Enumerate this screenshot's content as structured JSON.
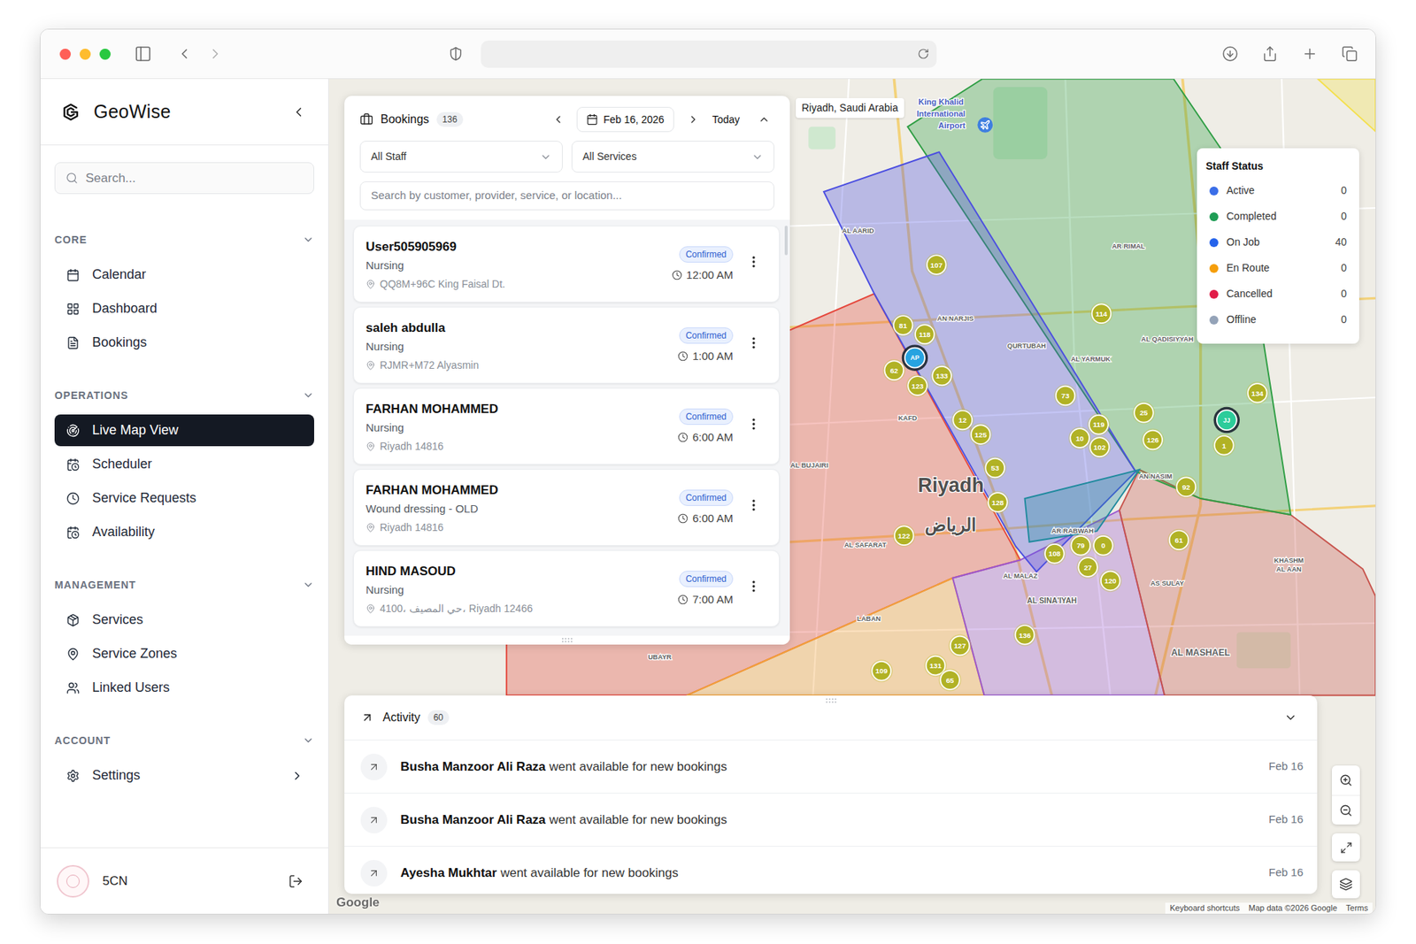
{
  "sidebar": {
    "brand": "GeoWise",
    "search_placeholder": "Search...",
    "sections": [
      {
        "title": "CORE",
        "expanded": true,
        "items": [
          {
            "label": "Calendar",
            "selected": false,
            "submenu": false
          },
          {
            "label": "Dashboard",
            "selected": false,
            "submenu": false
          },
          {
            "label": "Bookings",
            "selected": false,
            "submenu": false
          }
        ]
      },
      {
        "title": "OPERATIONS",
        "expanded": true,
        "items": [
          {
            "label": "Live Map View",
            "selected": true,
            "submenu": false
          },
          {
            "label": "Scheduler",
            "selected": false,
            "submenu": false
          },
          {
            "label": "Service Requests",
            "selected": false,
            "submenu": false
          },
          {
            "label": "Availability",
            "selected": false,
            "submenu": false
          }
        ]
      },
      {
        "title": "MANAGEMENT",
        "expanded": true,
        "items": [
          {
            "label": "Services",
            "selected": false,
            "submenu": false
          },
          {
            "label": "Service Zones",
            "selected": false,
            "submenu": false
          },
          {
            "label": "Linked Users",
            "selected": false,
            "submenu": false
          }
        ]
      },
      {
        "title": "ACCOUNT",
        "expanded": true,
        "items": [
          {
            "label": "Settings",
            "selected": false,
            "submenu": true
          }
        ]
      }
    ],
    "user": {
      "name": "5CN"
    }
  },
  "bookings": {
    "title": "Bookings",
    "count": "136",
    "date": "Feb 16, 2026",
    "today": "Today",
    "expanded": true,
    "staff_filter": "All Staff",
    "service_filter": "All Services",
    "search_placeholder": "Search by customer, provider, service, or location...",
    "items": [
      {
        "name": "User505905969",
        "service": "Nursing",
        "location": "QQ8M+96C King Faisal Dt.",
        "status": "Confirmed",
        "time": "12:00 AM"
      },
      {
        "name": "saleh abdulla",
        "service": "Nursing",
        "location": "RJMR+M72 Alyasmin",
        "status": "Confirmed",
        "time": "1:00 AM"
      },
      {
        "name": "FARHAN MOHAMMED",
        "service": "Nursing",
        "location": "Riyadh 14816",
        "status": "Confirmed",
        "time": "6:00 AM"
      },
      {
        "name": "FARHAN MOHAMMED",
        "service": "Wound dressing - OLD",
        "location": "Riyadh 14816",
        "status": "Confirmed",
        "time": "6:00 AM"
      },
      {
        "name": "HIND MASOUD",
        "service": "Nursing",
        "location": "4100، حي المصيف، Riyadh 12466",
        "status": "Confirmed",
        "time": "7:00 AM"
      }
    ]
  },
  "staff_status": {
    "title": "Staff Status",
    "items": [
      {
        "label": "Active",
        "count": "0",
        "color": "#3b6ee8"
      },
      {
        "label": "Completed",
        "count": "0",
        "color": "#1f9d55"
      },
      {
        "label": "On Job",
        "count": "40",
        "color": "#2563eb"
      },
      {
        "label": "En Route",
        "count": "0",
        "color": "#f59e0b"
      },
      {
        "label": "Cancelled",
        "count": "0",
        "color": "#e11d48"
      },
      {
        "label": "Offline",
        "count": "0",
        "color": "#94a3b8"
      }
    ]
  },
  "activity": {
    "title": "Activity",
    "count": "60",
    "expanded": true,
    "items": [
      {
        "name": "Busha Manzoor Ali Raza",
        "action": "went available for new bookings",
        "date": "Feb 16"
      },
      {
        "name": "Busha Manzoor Ali Raza",
        "action": "went available for new bookings",
        "date": "Feb 16"
      },
      {
        "name": "Ayesha Mukhtar",
        "action": "went available for new bookings",
        "date": "Feb 16"
      }
    ]
  },
  "map": {
    "location_chip": "Riyadh, Saudi Arabia",
    "zones": [
      {
        "color": "#e5483d"
      },
      {
        "color": "#f2a23a"
      },
      {
        "color": "#9b59d0"
      },
      {
        "color": "#c8554e"
      },
      {
        "color": "#2f9e44"
      },
      {
        "color": "#4c4fe0"
      },
      {
        "color": "#1f8a9e"
      },
      {
        "color": "#f4e04d"
      }
    ],
    "labels": [
      "King Khalid",
      "International",
      "Airport",
      "AL AARID",
      "AN NARJIS",
      "QURTUBAH",
      "AR RIMAL",
      "AL YARMUK",
      "AL QADISIYYAH",
      "KAFD",
      "AL BUJAIRI",
      "Riyadh",
      "الرياض",
      "AL SAFARAT",
      "AR RABWAH",
      "AL MALAZ",
      "AL SINA'IYAH",
      "AS SULAY",
      "AL MASHAEL",
      "KHASHM",
      "AL AAN",
      "LABAN",
      "UBAYR",
      "AN NASIM"
    ],
    "clusters": [
      "107",
      "81",
      "118",
      "62",
      "123",
      "133",
      "114",
      "73",
      "25",
      "119",
      "10",
      "102",
      "126",
      "12",
      "125",
      "53",
      "128",
      "92",
      "61",
      "122",
      "108",
      "79",
      "0",
      "27",
      "120",
      "134",
      "1",
      "136",
      "127",
      "109",
      "131",
      "65"
    ],
    "staff_pins": [
      {
        "initials": "AP",
        "color": "#27a3e0"
      },
      {
        "initials": "JJ",
        "color": "#2dcc9a"
      }
    ],
    "attribution": {
      "logo": "Google",
      "shortcuts": "Keyboard shortcuts",
      "data": "Map data ©2026 Google",
      "terms": "Terms"
    }
  }
}
